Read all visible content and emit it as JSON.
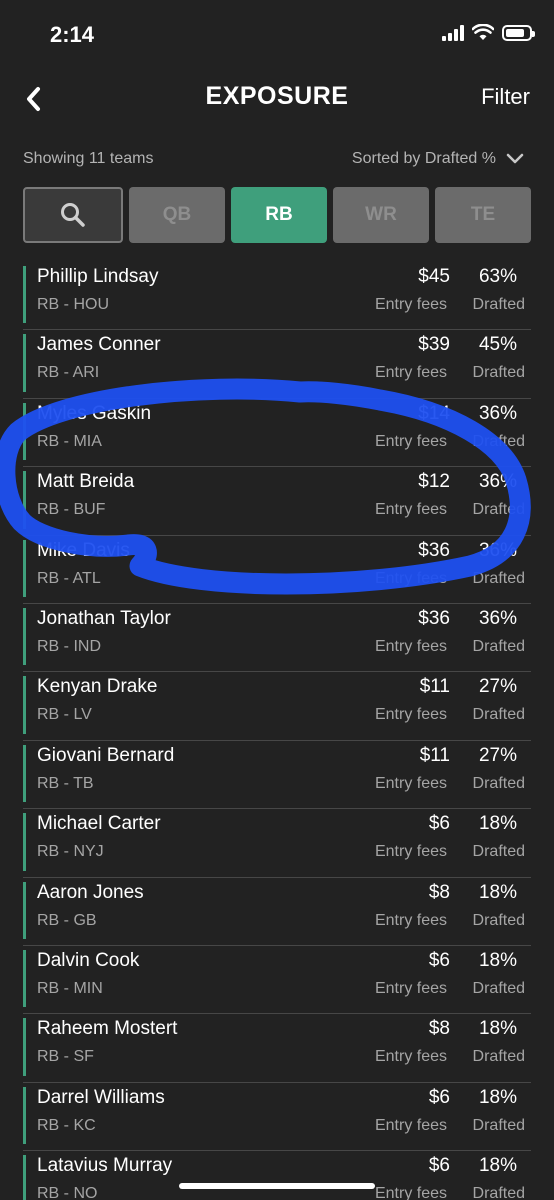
{
  "status_bar": {
    "time": "2:14"
  },
  "header": {
    "title": "EXPOSURE",
    "filter_label": "Filter"
  },
  "summary": {
    "count_text": "Showing 11 teams",
    "sort_text": "Sorted by Drafted %"
  },
  "tabs": [
    {
      "label": "",
      "icon": "search-icon",
      "active": false
    },
    {
      "label": "QB",
      "active": false
    },
    {
      "label": "RB",
      "active": true
    },
    {
      "label": "WR",
      "active": false
    },
    {
      "label": "TE",
      "active": false
    }
  ],
  "fee_label": "Entry fees",
  "drafted_label": "Drafted",
  "players": [
    {
      "name": "Phillip Lindsay",
      "meta": "RB - HOU",
      "fee": "$45",
      "pct": "63%"
    },
    {
      "name": "James Conner",
      "meta": "RB - ARI",
      "fee": "$39",
      "pct": "45%"
    },
    {
      "name": "Myles Gaskin",
      "meta": "RB - MIA",
      "fee": "$14",
      "pct": "36%"
    },
    {
      "name": "Matt Breida",
      "meta": "RB - BUF",
      "fee": "$12",
      "pct": "36%"
    },
    {
      "name": "Mike Davis",
      "meta": "RB - ATL",
      "fee": "$36",
      "pct": "36%"
    },
    {
      "name": "Jonathan Taylor",
      "meta": "RB - IND",
      "fee": "$36",
      "pct": "36%"
    },
    {
      "name": "Kenyan Drake",
      "meta": "RB - LV",
      "fee": "$11",
      "pct": "27%"
    },
    {
      "name": "Giovani Bernard",
      "meta": "RB - TB",
      "fee": "$11",
      "pct": "27%"
    },
    {
      "name": "Michael Carter",
      "meta": "RB - NYJ",
      "fee": "$6",
      "pct": "18%"
    },
    {
      "name": "Aaron Jones",
      "meta": "RB - GB",
      "fee": "$8",
      "pct": "18%"
    },
    {
      "name": "Dalvin Cook",
      "meta": "RB - MIN",
      "fee": "$6",
      "pct": "18%"
    },
    {
      "name": "Raheem Mostert",
      "meta": "RB - SF",
      "fee": "$8",
      "pct": "18%"
    },
    {
      "name": "Darrel Williams",
      "meta": "RB - KC",
      "fee": "$6",
      "pct": "18%"
    },
    {
      "name": "Latavius Murray",
      "meta": "RB - NO",
      "fee": "$6",
      "pct": "18%"
    }
  ],
  "colors": {
    "accent": "#3f9f7c",
    "background": "#222222",
    "annotation": "#1f50f0"
  }
}
